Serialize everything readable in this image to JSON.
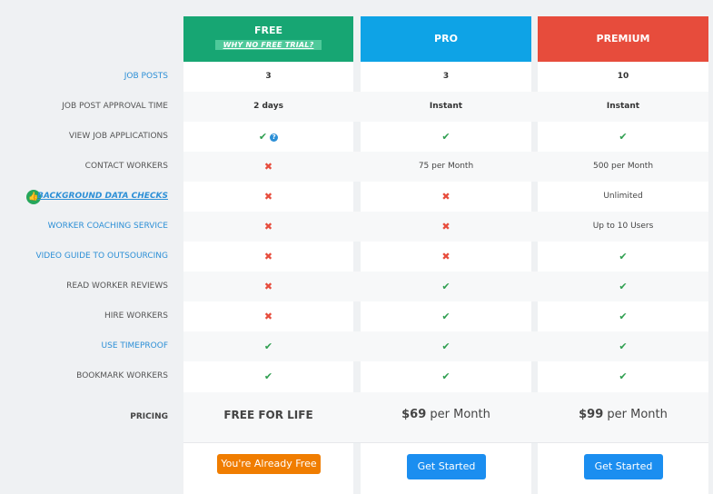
{
  "plans": {
    "free": {
      "title": "FREE",
      "sub": "WHY NO FREE TRIAL?",
      "color": "#17a673"
    },
    "pro": {
      "title": "PRO",
      "color": "#0ea3e6"
    },
    "premium": {
      "title": "PREMIUM",
      "color": "#e74c3c"
    }
  },
  "rows": [
    {
      "label": "JOB POSTS",
      "free": "3",
      "pro": "3",
      "premium": "10"
    },
    {
      "label": "JOB POST APPROVAL TIME",
      "free": "2 days",
      "pro": "Instant",
      "premium": "Instant"
    },
    {
      "label": "VIEW JOB APPLICATIONS",
      "free": "✔",
      "free_help": "?",
      "pro": "✔",
      "premium": "✔"
    },
    {
      "label": "CONTACT WORKERS",
      "free": "✖",
      "pro": "75 per Month",
      "premium": "500 per Month"
    },
    {
      "label": "BACKGROUND DATA CHECKS",
      "free": "✖",
      "pro": "✖",
      "premium": "Unlimited"
    },
    {
      "label": "WORKER COACHING SERVICE",
      "free": "✖",
      "pro": "✖",
      "premium": "Up to 10 Users"
    },
    {
      "label": "VIDEO GUIDE TO OUTSOURCING",
      "free": "✖",
      "pro": "✖",
      "premium": "✔"
    },
    {
      "label": "READ WORKER REVIEWS",
      "free": "✖",
      "pro": "✔",
      "premium": "✔"
    },
    {
      "label": "HIRE WORKERS",
      "free": "✖",
      "pro": "✔",
      "premium": "✔"
    },
    {
      "label": "USE TIMEPROOF",
      "free": "✔",
      "pro": "✔",
      "premium": "✔"
    },
    {
      "label": "BOOKMARK WORKERS",
      "free": "✔",
      "pro": "✔",
      "premium": "✔"
    }
  ],
  "pricing": {
    "label": "PRICING",
    "free": "FREE FOR LIFE",
    "pro_amount": "$69",
    "pro_period": "per Month",
    "premium_amount": "$99",
    "premium_period": "per Month"
  },
  "buttons": {
    "free": "You're Already Free",
    "pro": "Get Started",
    "premium": "Get Started"
  },
  "badge_icon": "thumbs-up-badge-icon"
}
